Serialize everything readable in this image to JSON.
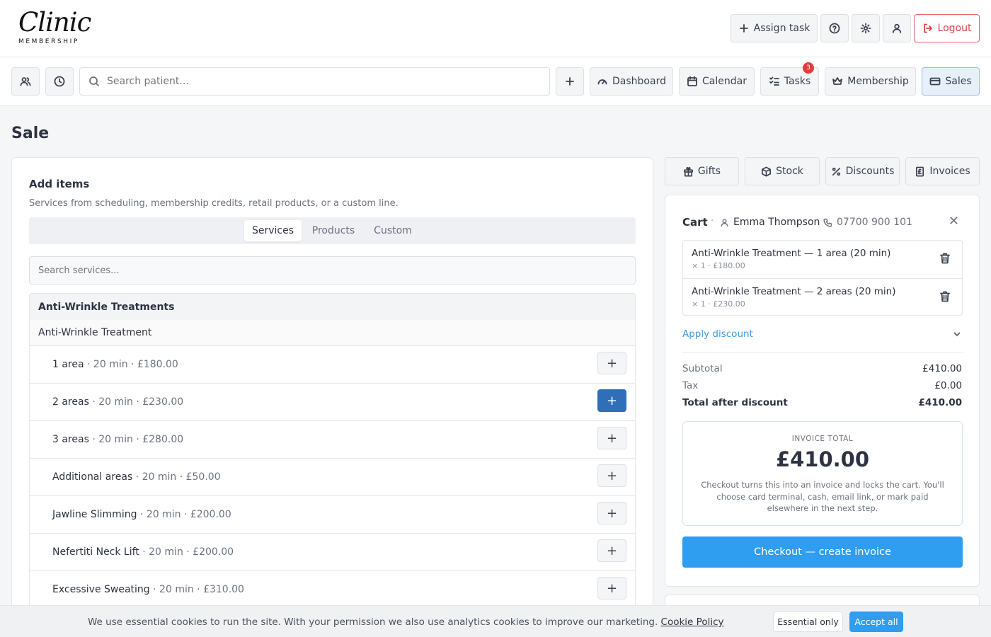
{
  "brand": {
    "script": "Clinic",
    "sub": "MEMBERSHIP"
  },
  "header": {
    "assign_task": "Assign task",
    "logout": "Logout"
  },
  "nav": {
    "search_placeholder": "Search patient...",
    "dashboard": "Dashboard",
    "calendar": "Calendar",
    "tasks": "Tasks",
    "tasks_badge": "3",
    "membership": "Membership",
    "sales": "Sales"
  },
  "page": {
    "title": "Sale"
  },
  "add_items": {
    "title": "Add items",
    "description": "Services from scheduling, membership credits, retail products, or a custom line.",
    "tabs": [
      "Services",
      "Products",
      "Custom"
    ],
    "search_placeholder": "Search services...",
    "category": "Anti-Wrinkle Treatments",
    "subcategory": "Anti-Wrinkle Treatment",
    "rows": [
      {
        "name": "1 area",
        "meta": " · 20 min · £180.00",
        "add": "+"
      },
      {
        "name": "2 areas",
        "meta": " · 20 min · £230.00",
        "add": "+"
      },
      {
        "name": "3 areas",
        "meta": " · 20 min · £280.00",
        "add": "+"
      },
      {
        "name": "Additional areas",
        "meta": " · 20 min · £50.00",
        "add": "+"
      },
      {
        "name": "Jawline Slimming",
        "meta": " · 20 min · £200.00",
        "add": "+"
      },
      {
        "name": "Nefertiti Neck Lift",
        "meta": " · 20 min · £200.00",
        "add": "+"
      },
      {
        "name": "Excessive Sweating",
        "meta": " · 20 min · £310.00",
        "add": "+"
      }
    ]
  },
  "quick_actions": {
    "gifts": "Gifts",
    "stock": "Stock",
    "discounts": "Discounts",
    "invoices": "Invoices"
  },
  "cart": {
    "title": "Cart",
    "separator": "·",
    "customer": "Emma Thompson",
    "phone": "07700 900 101",
    "close": "✕",
    "items": [
      {
        "name": "Anti-Wrinkle Treatment — 1 area (20 min)",
        "sub": "× 1 · £180.00"
      },
      {
        "name": "Anti-Wrinkle Treatment — 2 areas (20 min)",
        "sub": "× 1 · £230.00"
      }
    ],
    "apply_discount": "Apply discount",
    "subtotal_label": "Subtotal",
    "subtotal": "£410.00",
    "tax_label": "Tax",
    "tax": "£0.00",
    "total_label": "Total after discount",
    "total": "£410.00",
    "invoice_label": "INVOICE TOTAL",
    "invoice_total": "£410.00",
    "invoice_note": "Checkout turns this into an invoice and locks the cart. You'll choose card terminal, cash, email link, or mark paid elsewhere in the next step.",
    "checkout": "Checkout — create invoice"
  },
  "cookie": {
    "text": "We use essential cookies to run the site. With your permission we also use analytics cookies to improve our marketing. ",
    "link": "Cookie Policy",
    "essential": "Essential only",
    "accept": "Accept all"
  },
  "colors": {
    "primary": "#2f9df0",
    "active_add": "#2f6fb8",
    "danger": "#d64545",
    "badge": "#e23d3d"
  }
}
